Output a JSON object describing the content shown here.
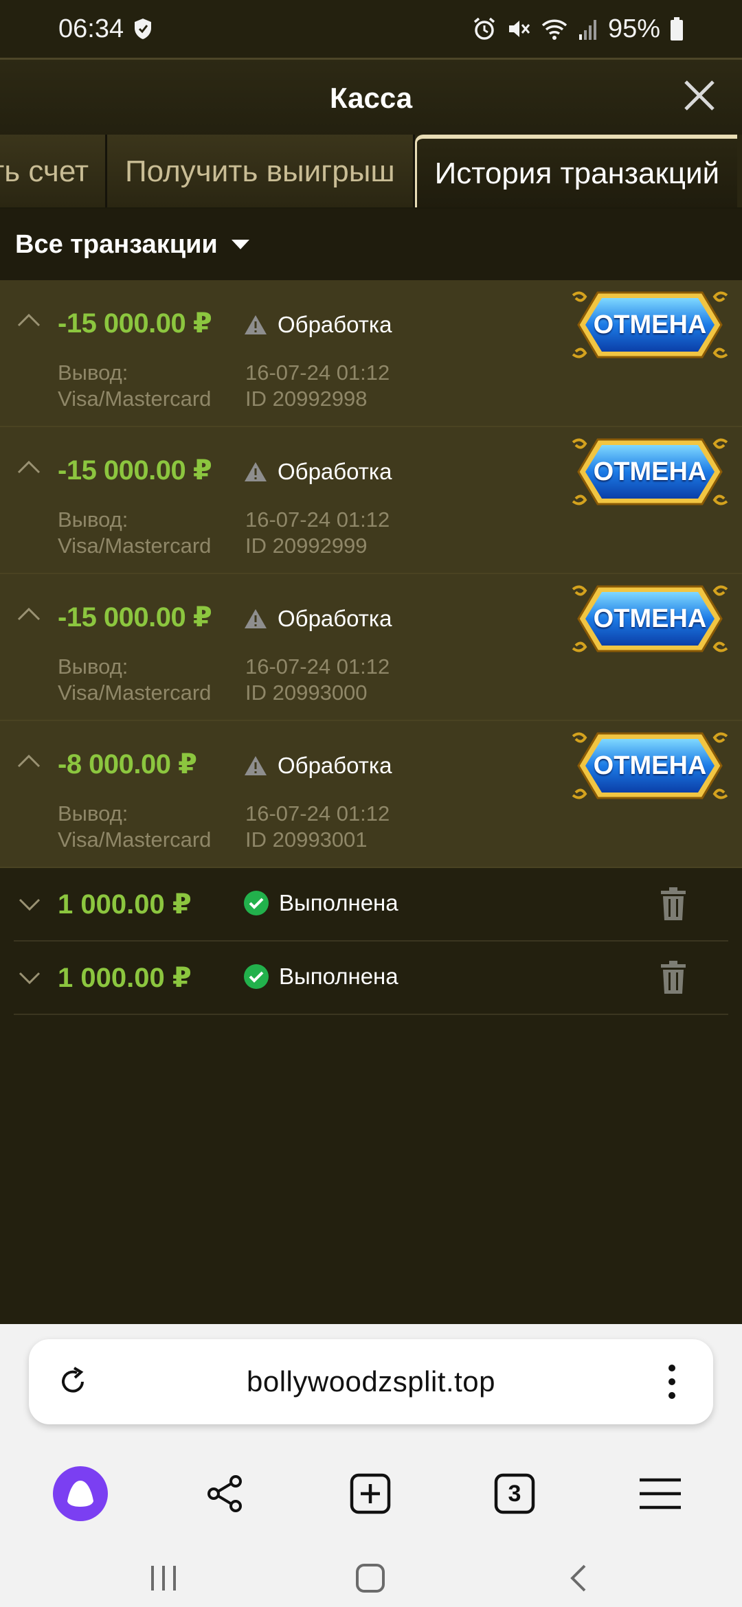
{
  "status_bar": {
    "time": "06:34",
    "battery": "95%"
  },
  "header": {
    "title": "Касса"
  },
  "tabs": [
    {
      "label": "ть счет"
    },
    {
      "label": "Получить выигрыш"
    },
    {
      "label": "История транзакций"
    }
  ],
  "filter": {
    "label": "Все транзакции"
  },
  "pending": [
    {
      "amount": "-15 000.00 ₽",
      "status": "Обработка",
      "method_line1": "Вывод:",
      "method_line2": "Visa/Mastercard",
      "date": "16-07-24 01:12",
      "id": "ID 20992998",
      "cancel_label": "ОТМЕНА"
    },
    {
      "amount": "-15 000.00 ₽",
      "status": "Обработка",
      "method_line1": "Вывод:",
      "method_line2": "Visa/Mastercard",
      "date": "16-07-24 01:12",
      "id": "ID 20992999",
      "cancel_label": "ОТМЕНА"
    },
    {
      "amount": "-15 000.00 ₽",
      "status": "Обработка",
      "method_line1": "Вывод:",
      "method_line2": "Visa/Mastercard",
      "date": "16-07-24 01:12",
      "id": "ID 20993000",
      "cancel_label": "ОТМЕНА"
    },
    {
      "amount": "-8 000.00 ₽",
      "status": "Обработка",
      "method_line1": "Вывод:",
      "method_line2": "Visa/Mastercard",
      "date": "16-07-24 01:12",
      "id": "ID 20993001",
      "cancel_label": "ОТМЕНА"
    }
  ],
  "completed": [
    {
      "amount": "1 000.00 ₽",
      "status": "Выполнена"
    },
    {
      "amount": "1 000.00 ₽",
      "status": "Выполнена"
    }
  ],
  "browser": {
    "url": "bollywoodzsplit.top",
    "tab_count": "3",
    "accent_color": "#7b3ff2"
  },
  "colors": {
    "amount_green": "#8cc63f",
    "pending_bg": "#403a1d",
    "page_bg": "#23200f"
  }
}
